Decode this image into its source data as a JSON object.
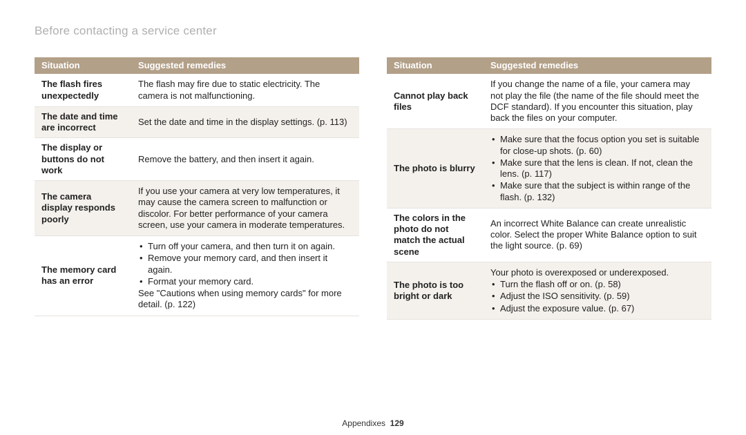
{
  "page_title": "Before contacting a service center",
  "headers": {
    "situation": "Situation",
    "remedies": "Suggested remedies"
  },
  "left_rows": [
    {
      "situation": "The flash fires unexpectedly",
      "remedy_paras": [
        "The flash may fire due to static electricity. The camera is not malfunctioning."
      ],
      "remedy_bullets": []
    },
    {
      "situation": "The date and time are incorrect",
      "remedy_paras": [
        "Set the date and time in the display settings. (p. 113)"
      ],
      "remedy_bullets": []
    },
    {
      "situation": "The display or buttons do not work",
      "remedy_paras": [
        "Remove the battery, and then insert it again."
      ],
      "remedy_bullets": []
    },
    {
      "situation": "The camera display responds poorly",
      "remedy_paras": [
        "If you use your camera at very low temperatures, it may cause the camera screen to malfunction or discolor. For better performance of your camera screen, use your camera in moderate temperatures."
      ],
      "remedy_bullets": []
    },
    {
      "situation": "The memory card has an error",
      "remedy_paras": [],
      "remedy_bullets": [
        "Turn off your camera, and then turn it on again.",
        "Remove your memory card, and then insert it again.",
        "Format your memory card."
      ],
      "remedy_after": "See \"Cautions when using memory cards\" for more detail. (p. 122)"
    }
  ],
  "right_rows": [
    {
      "situation": "Cannot play back files",
      "remedy_paras": [
        "If you change the name of a file, your camera may not play the file (the name of the file should meet the DCF standard). If you encounter this situation, play back the files on your computer."
      ],
      "remedy_bullets": []
    },
    {
      "situation": "The photo is blurry",
      "remedy_paras": [],
      "remedy_bullets": [
        "Make sure that the focus option you set is suitable for close-up shots. (p. 60)",
        "Make sure that the lens is clean. If not, clean the lens. (p. 117)",
        "Make sure that the subject is within range of the flash. (p. 132)"
      ]
    },
    {
      "situation": "The colors in the photo do not match the actual scene",
      "remedy_paras": [
        "An incorrect White Balance can create unrealistic color. Select the proper White Balance option to suit the light source. (p. 69)"
      ],
      "remedy_bullets": []
    },
    {
      "situation": "The photo is too bright or dark",
      "remedy_paras": [
        "Your photo is overexposed or underexposed."
      ],
      "remedy_bullets": [
        "Turn the flash off or on. (p. 58)",
        "Adjust the ISO sensitivity. (p. 59)",
        "Adjust the exposure value. (p. 67)"
      ]
    }
  ],
  "footer": {
    "section": "Appendixes",
    "page": "129"
  }
}
